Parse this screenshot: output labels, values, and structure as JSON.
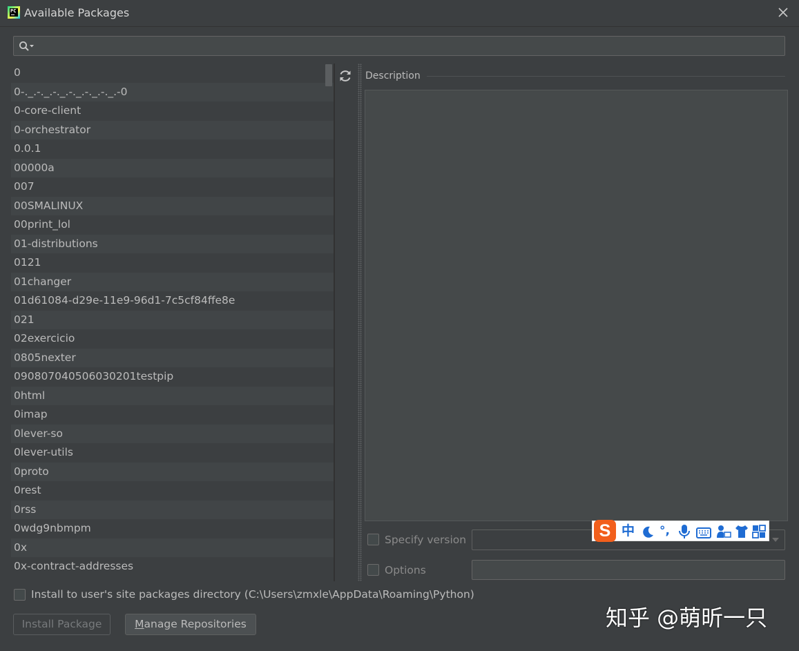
{
  "window": {
    "title": "Available Packages"
  },
  "search": {
    "value": "",
    "placeholder": ""
  },
  "packages": [
    "0",
    "0-._.-._.-._.-._.-._.-._.-0",
    "0-core-client",
    "0-orchestrator",
    "0.0.1",
    "00000a",
    "007",
    "00SMALINUX",
    "00print_lol",
    "01-distributions",
    "0121",
    "01changer",
    "01d61084-d29e-11e9-96d1-7c5cf84ffe8e",
    "021",
    "02exercicio",
    "0805nexter",
    "090807040506030201testpip",
    "0html",
    "0imap",
    "0lever-so",
    "0lever-utils",
    "0proto",
    "0rest",
    "0rss",
    "0wdg9nbmpm",
    "0x",
    "0x-contract-addresses"
  ],
  "description": {
    "label": "Description",
    "content": ""
  },
  "options": {
    "specify_version_label": "Specify version",
    "specify_version_checked": false,
    "version_value": "",
    "options_label": "Options",
    "options_checked": false,
    "options_value": ""
  },
  "install_to_user": {
    "label": "Install to user's site packages directory (C:\\Users\\zmxle\\AppData\\Roaming\\Python)",
    "checked": false
  },
  "buttons": {
    "install": "Install Package",
    "manage_prefix": "M",
    "manage_rest": "anage Repositories"
  },
  "ime_toolbar": {
    "logo": "S",
    "mode": "中",
    "punct": "°,"
  },
  "watermark": "知乎 @萌昕一只",
  "colors": {
    "background": "#3c3f41",
    "row_alt": "#414547",
    "text": "#bbbbbb",
    "ime_blue": "#1f6cd3",
    "ime_orange": "#f25f1c"
  }
}
